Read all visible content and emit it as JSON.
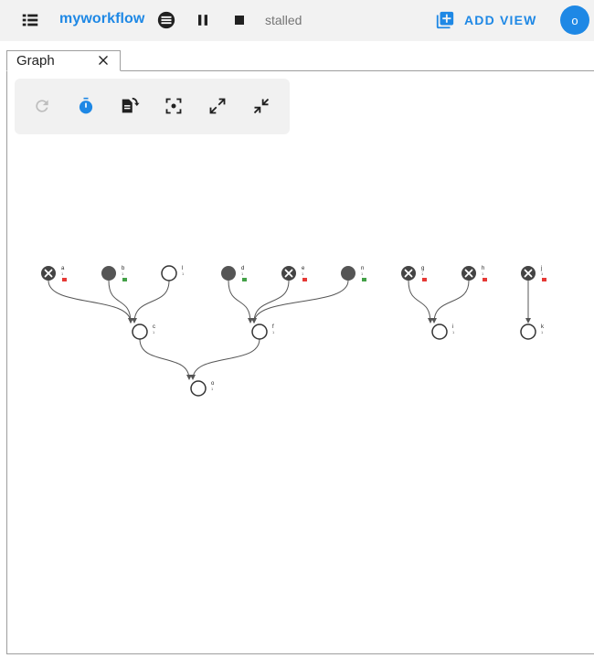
{
  "header": {
    "workflow_name": "myworkflow",
    "status": "stalled",
    "add_view_label": "ADD VIEW",
    "user_initial": "o",
    "icons": {
      "menu": "view-list-icon",
      "state": "stalled-state-icon",
      "pause": "pause-icon",
      "stop": "stop-icon",
      "add_view": "add-box-icon"
    },
    "accent_color": "#1e88e5"
  },
  "tabs": [
    {
      "label": "Graph",
      "close_icon": "close-icon"
    }
  ],
  "graph_toolbar": {
    "buttons": [
      {
        "name": "refresh",
        "icon": "refresh-icon",
        "enabled": false
      },
      {
        "name": "auto-refresh",
        "icon": "timer-icon",
        "active": true
      },
      {
        "name": "transpose",
        "icon": "file-rotate-icon"
      },
      {
        "name": "center",
        "icon": "center-focus-icon"
      },
      {
        "name": "expand",
        "icon": "expand-icon"
      },
      {
        "name": "collapse",
        "icon": "collapse-icon"
      }
    ]
  },
  "graph": {
    "nodes": [
      {
        "id": "a",
        "state": "failed",
        "sub": "1",
        "badge": "red"
      },
      {
        "id": "b",
        "state": "succeeded",
        "sub": "1",
        "badge": "green"
      },
      {
        "id": "l",
        "state": "waiting",
        "sub": "1"
      },
      {
        "id": "c",
        "state": "waiting",
        "sub": "1"
      },
      {
        "id": "d",
        "state": "succeeded",
        "sub": "1",
        "badge": "green"
      },
      {
        "id": "e",
        "state": "failed",
        "sub": "1",
        "badge": "red"
      },
      {
        "id": "n",
        "state": "succeeded",
        "sub": "1",
        "badge": "green"
      },
      {
        "id": "f",
        "state": "waiting",
        "sub": "1"
      },
      {
        "id": "g",
        "state": "failed",
        "sub": "1",
        "badge": "red"
      },
      {
        "id": "h",
        "state": "failed",
        "sub": "1",
        "badge": "red"
      },
      {
        "id": "i",
        "state": "waiting",
        "sub": "1"
      },
      {
        "id": "j",
        "state": "failed",
        "sub": "1",
        "badge": "red"
      },
      {
        "id": "k",
        "state": "waiting",
        "sub": "1"
      },
      {
        "id": "o",
        "state": "waiting",
        "sub": "1"
      }
    ],
    "edges": [
      [
        "a",
        "c"
      ],
      [
        "b",
        "c"
      ],
      [
        "l",
        "c"
      ],
      [
        "d",
        "f"
      ],
      [
        "e",
        "f"
      ],
      [
        "n",
        "f"
      ],
      [
        "g",
        "i"
      ],
      [
        "h",
        "i"
      ],
      [
        "j",
        "k"
      ],
      [
        "c",
        "o"
      ],
      [
        "f",
        "o"
      ]
    ],
    "colors": {
      "edge": "#555555",
      "node_fill": "#555555",
      "failed_badge": "#e53935",
      "succeeded_badge": "#43a047"
    }
  }
}
